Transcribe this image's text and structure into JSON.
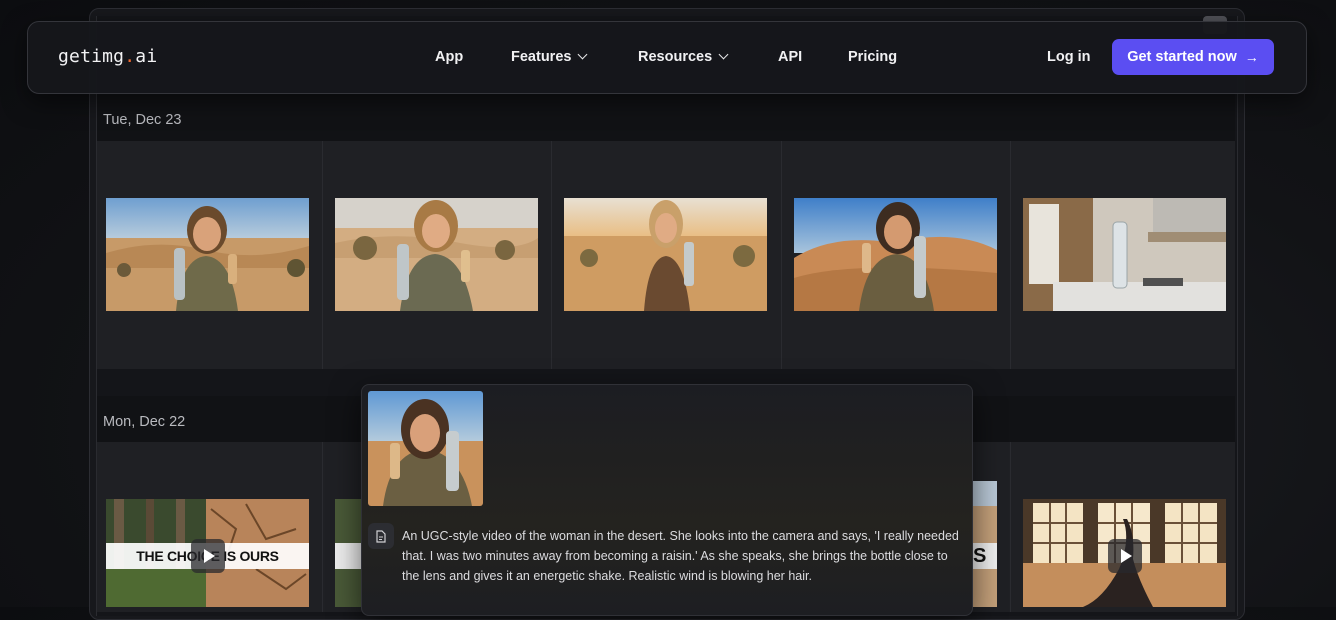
{
  "nav": {
    "logo_main": "getimg",
    "logo_dot": ".",
    "logo_suffix": "ai",
    "links": [
      {
        "label": "App"
      },
      {
        "label": "Features"
      },
      {
        "label": "Resources"
      },
      {
        "label": "API"
      },
      {
        "label": "Pricing"
      }
    ],
    "login": "Log in",
    "cta": "Get started now",
    "cta_arrow": "→"
  },
  "sections": [
    {
      "date": "Tue, Dec 23"
    },
    {
      "date": "Mon, Dec 22"
    }
  ],
  "thumbnail_overlays": {
    "choice_text": "THE CHOICE IS OURS",
    "edge_text": "S"
  },
  "popup": {
    "prompt": "An UGC-style video of the woman in the desert. She looks into the camera and says, 'I really needed that. I was two minutes away from becoming a raisin.' As she speaks, she brings the bottle close to the lens and gives it an energetic shake. Realistic wind is blowing her hair."
  },
  "colors": {
    "accent": "#5b4ef2",
    "logo_dot": "#f26a2e",
    "background": "#141519"
  }
}
